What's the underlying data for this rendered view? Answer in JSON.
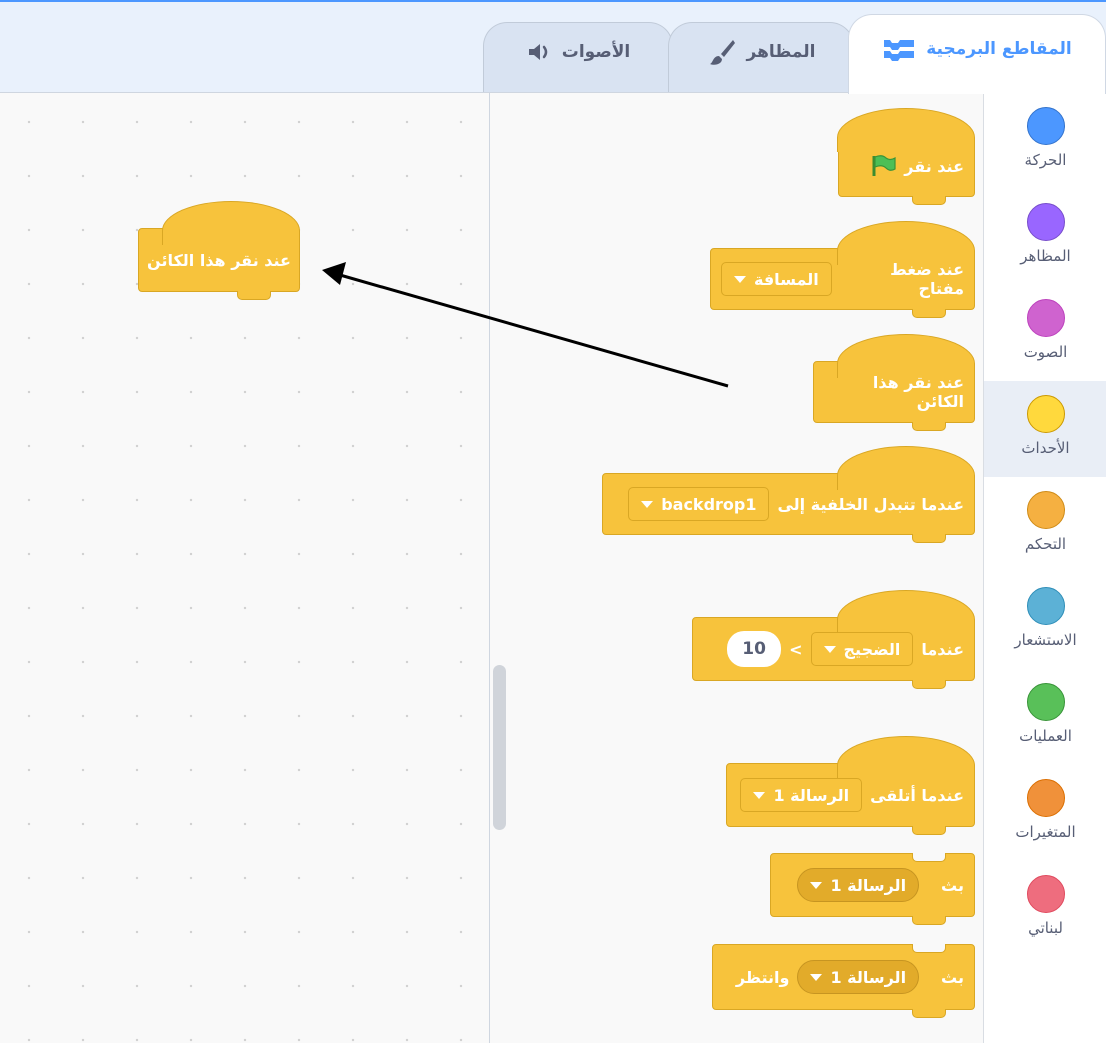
{
  "tabs": {
    "code": "المقاطع البرمجية",
    "costumes": "المظاهر",
    "sounds": "الأصوات"
  },
  "colors": {
    "events": "#f7c33c",
    "accent": "#4c97ff"
  },
  "categories": [
    {
      "label": "الحركة",
      "color": "#4c97ff"
    },
    {
      "label": "المظاهر",
      "color": "#9966ff"
    },
    {
      "label": "الصوت",
      "color": "#cf63cf"
    },
    {
      "label": "الأحداث",
      "color": "#ffd93d"
    },
    {
      "label": "التحكم",
      "color": "#f5b041"
    },
    {
      "label": "الاستشعار",
      "color": "#5cb1d6"
    },
    {
      "label": "العمليات",
      "color": "#59c059"
    },
    {
      "label": "المتغيرات",
      "color": "#f0913a"
    },
    {
      "label": "لبناتي",
      "color": "#ee6d7e"
    }
  ],
  "blocks": {
    "flag_clicked": {
      "text": "عند نقر"
    },
    "key_pressed": {
      "text": "عند ضغط مفتاح",
      "dropdown": "المسافة"
    },
    "sprite_clicked": {
      "text": "عند نقر هذا الكائن"
    },
    "backdrop_switch": {
      "text": "عندما تتبدل الخلفية إلى",
      "dropdown": "backdrop1"
    },
    "greater_than": {
      "text": "عندما",
      "dropdown": "الضجيج",
      "operator": ">",
      "value": "10"
    },
    "receive": {
      "text": "عندما أتلقى",
      "dropdown": "الرسالة 1"
    },
    "broadcast": {
      "text": "بث",
      "dropdown": "الرسالة 1"
    },
    "broadcast_wait": {
      "text": "بث",
      "dropdown": "الرسالة 1",
      "suffix": "وانتظر"
    }
  },
  "workspace": {
    "placed_block": "عند نقر هذا الكائن"
  }
}
